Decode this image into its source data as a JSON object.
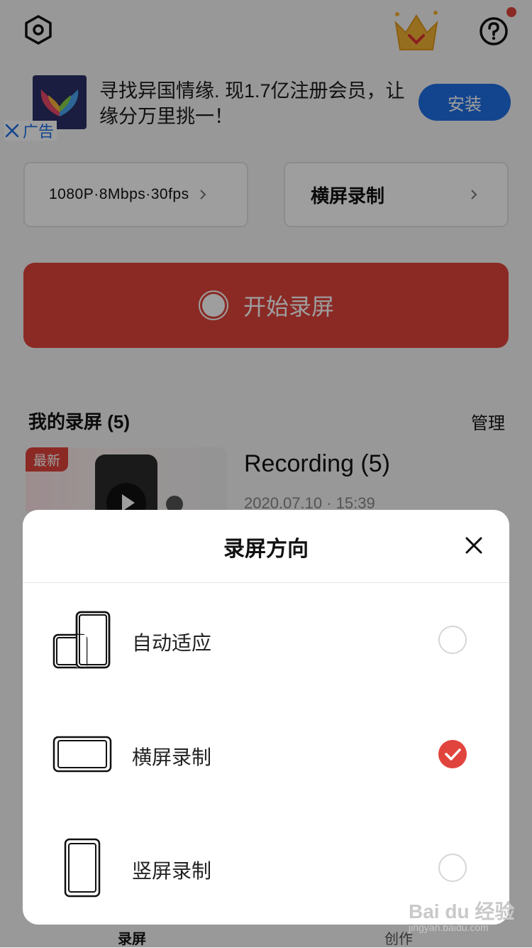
{
  "header": {
    "settings_icon": "hexagon-settings-icon",
    "vip_icon": "crown-icon",
    "help_icon": "question-icon",
    "help_badge_color": "#e0443d"
  },
  "ad": {
    "text": "寻找异国情缘. 现1.7亿注册会员，让缘分万里挑一！",
    "install_label": "安装",
    "tag_label": "广告",
    "accent": "#1f6fe6"
  },
  "settings": {
    "quality_label": "1080P·8Mbps·30fps",
    "orientation_label": "横屏录制"
  },
  "start": {
    "label": "开始录屏",
    "color": "#e0443d"
  },
  "recordings": {
    "title": "我的录屏 (5)",
    "manage_label": "管理",
    "items": [
      {
        "badge": "最新",
        "title": "Recording (5)",
        "time": "2020.07.10 · 15:39"
      }
    ]
  },
  "tabbar": {
    "tabs": [
      {
        "label": "录屏"
      },
      {
        "label": "创作"
      }
    ]
  },
  "sheet": {
    "title": "录屏方向",
    "options": [
      {
        "label": "自动适应",
        "icon": "auto-rotate-phone-icon",
        "checked": false
      },
      {
        "label": "横屏录制",
        "icon": "landscape-phone-icon",
        "checked": true
      },
      {
        "label": "竖屏录制",
        "icon": "portrait-phone-icon",
        "checked": false
      }
    ]
  },
  "watermark": {
    "text": "Bai du 经验",
    "sub": "jingyan.baidu.com"
  }
}
